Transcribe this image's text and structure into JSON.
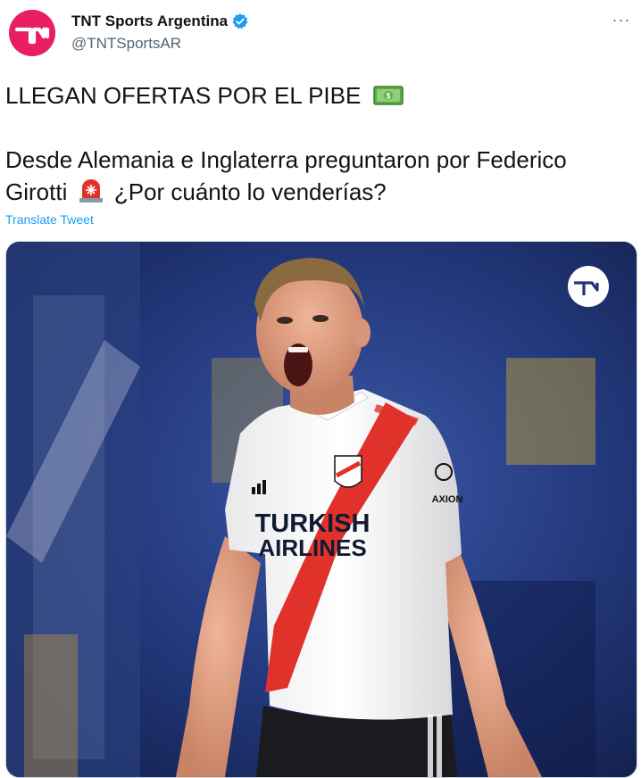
{
  "account": {
    "display_name": "TNT Sports Argentina",
    "handle": "@TNTSportsAR",
    "verified": true,
    "avatar_icon": "tnt-sports-logo",
    "avatar_color": "#ea1f63"
  },
  "more_button": {
    "label": "···",
    "icon": "more-icon"
  },
  "tweet": {
    "line1": "LLEGAN OFERTAS POR EL PIBE",
    "line1_emoji": "money-bill-emoji",
    "line2a": "Desde Alemania e Inglaterra preguntaron por Federico",
    "line2b": "Girotti",
    "line2_emoji": "siren-emoji",
    "line2c": "¿Por cuánto lo venderías?"
  },
  "translate_label": "Translate Tweet",
  "media": {
    "description_icon": "photo",
    "jersey_text_line1": "TURKISH",
    "jersey_text_line2": "AIRLINES",
    "sleeve_text": "AXION",
    "watermark_icon": "tnt-sports-watermark"
  },
  "colors": {
    "link": "#1d9bf0",
    "secondary_text": "#536471",
    "verified": "#1d9bf0",
    "river_red": "#e0322b"
  }
}
